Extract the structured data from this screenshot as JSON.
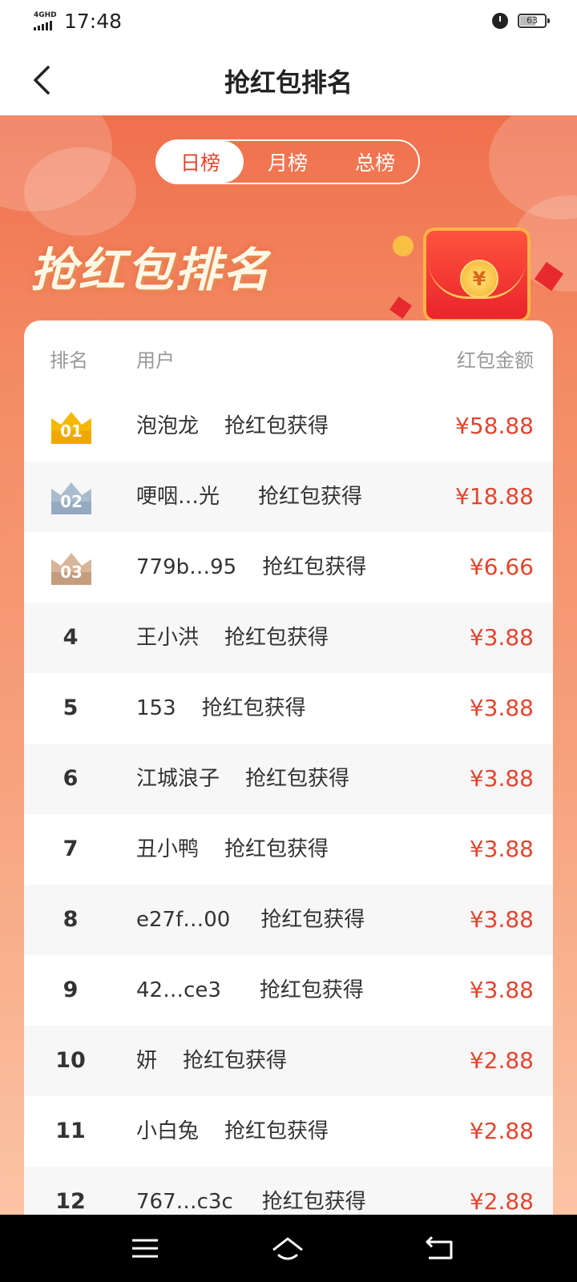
{
  "status_bar": {
    "network": "4GHD",
    "time": "17:48",
    "battery_level": "63"
  },
  "nav": {
    "title": "抢红包排名"
  },
  "tabs": [
    {
      "label": "日榜",
      "active": true
    },
    {
      "label": "月榜",
      "active": false
    },
    {
      "label": "总榜",
      "active": false
    }
  ],
  "hero": {
    "title": "抢红包排名",
    "coin_symbol": "¥"
  },
  "table": {
    "headers": {
      "rank": "排名",
      "user": "用户",
      "amount": "红包金额"
    },
    "rows": [
      {
        "rank": "01",
        "user": "泡泡龙",
        "action": "抢红包获得",
        "amount": "¥58.88"
      },
      {
        "rank": "02",
        "user": "哽咽…光",
        "action": "抢红包获得",
        "amount": "¥18.88"
      },
      {
        "rank": "03",
        "user": "779b…95",
        "action": "抢红包获得",
        "amount": "¥6.66"
      },
      {
        "rank": "4",
        "user": "王小洪",
        "action": "抢红包获得",
        "amount": "¥3.88"
      },
      {
        "rank": "5",
        "user": "153",
        "action": "抢红包获得",
        "amount": "¥3.88"
      },
      {
        "rank": "6",
        "user": "江城浪子",
        "action": "抢红包获得",
        "amount": "¥3.88"
      },
      {
        "rank": "7",
        "user": "丑小鸭",
        "action": "抢红包获得",
        "amount": "¥3.88"
      },
      {
        "rank": "8",
        "user": "e27f…00",
        "action": "抢红包获得",
        "amount": "¥3.88"
      },
      {
        "rank": "9",
        "user": "42…ce3",
        "action": "抢红包获得",
        "amount": "¥3.88"
      },
      {
        "rank": "10",
        "user": "妍",
        "action": "抢红包获得",
        "amount": "¥2.88"
      },
      {
        "rank": "11",
        "user": "小白兔",
        "action": "抢红包获得",
        "amount": "¥2.88"
      },
      {
        "rank": "12",
        "user": "767…c3c",
        "action": "抢红包获得",
        "amount": "¥2.88"
      }
    ]
  },
  "colors": {
    "accent_red": "#e3452e",
    "gold": "#f5b800",
    "silver": "#9fb3c8",
    "bronze": "#caa58a"
  },
  "icons": {
    "back": "chevron-left-icon",
    "menu": "menu-icon",
    "home": "home-icon",
    "return": "return-icon"
  }
}
